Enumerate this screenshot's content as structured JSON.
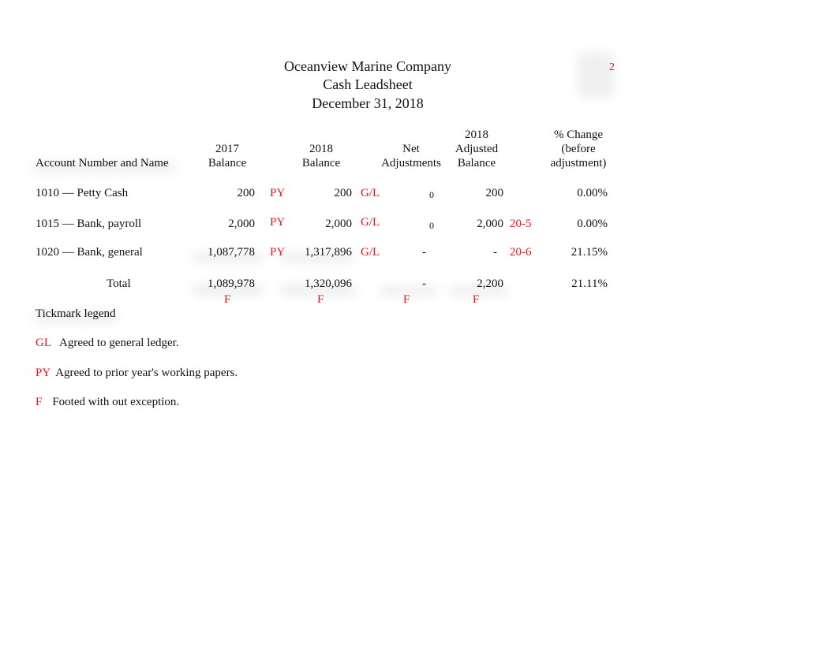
{
  "header": {
    "company": "Oceanview Marine Company",
    "title": "Cash Leadsheet",
    "date": "December 31, 2018",
    "page_ref": "2"
  },
  "columns": {
    "account": "Account Number and Name",
    "bal2017": [
      "2017",
      "Balance"
    ],
    "bal2018": [
      "2018",
      "Balance"
    ],
    "net_adj": [
      "Net",
      "Adjustments"
    ],
    "adj2018": [
      "2018",
      "Adjusted",
      "Balance"
    ],
    "pct_change": [
      "% Change",
      "(before",
      "adjustment)"
    ]
  },
  "rows": [
    {
      "account": "1010 — Petty Cash",
      "bal2017": "200",
      "tick2017": "PY",
      "bal2018": "200",
      "tick2018": "G/L",
      "net_adj": "0",
      "adj2018": "200",
      "ref": "",
      "pct_change": "0.00%"
    },
    {
      "account": "1015 — Bank, payroll",
      "bal2017": "2,000",
      "tick2017": "PY",
      "bal2018": "2,000",
      "tick2018": "G/L",
      "net_adj": "0",
      "adj2018": "2,000",
      "ref": "20-5",
      "pct_change": "0.00%"
    },
    {
      "account": "1020 — Bank, general",
      "bal2017": "1,087,778",
      "tick2017": "PY",
      "bal2018": "1,317,896",
      "tick2018": "G/L",
      "net_adj": "-",
      "adj2018": "-",
      "ref": "20-6",
      "pct_change": "21.15%"
    }
  ],
  "total": {
    "label": "Total",
    "bal2017": "1,089,978",
    "bal2018": "1,320,096",
    "net_adj": "-",
    "adj2018": "2,200",
    "pct_change": "21.11%",
    "footmarks": [
      "F",
      "F",
      "F",
      "F"
    ]
  },
  "legend": {
    "title": "Tickmark legend",
    "items": [
      {
        "mark": "GL",
        "text": "Agreed to general ledger."
      },
      {
        "mark": "PY",
        "text": "Agreed to prior year's working papers."
      },
      {
        "mark": "F",
        "text": "Footed with out exception."
      }
    ]
  },
  "colors": {
    "tickmark": "#e8141c",
    "text": "#111111"
  }
}
